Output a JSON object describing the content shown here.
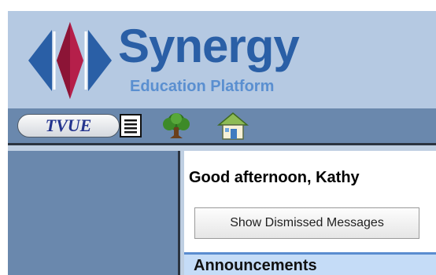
{
  "brand": {
    "name": "Synergy",
    "tagline": "Education Platform",
    "colors": {
      "primary": "#2a5fa6",
      "accent": "#5a8fd0",
      "mark_red": "#b51f4a",
      "mark_blue": "#2a5fa6"
    }
  },
  "toolbar": {
    "tvue_label": "TVUE",
    "icons": [
      "document-list-icon",
      "tree-icon",
      "home-icon"
    ]
  },
  "main": {
    "greeting": "Good afternoon, Kathy",
    "dismissed_button_label": "Show Dismissed Messages",
    "announcements_title": "Announcements"
  }
}
